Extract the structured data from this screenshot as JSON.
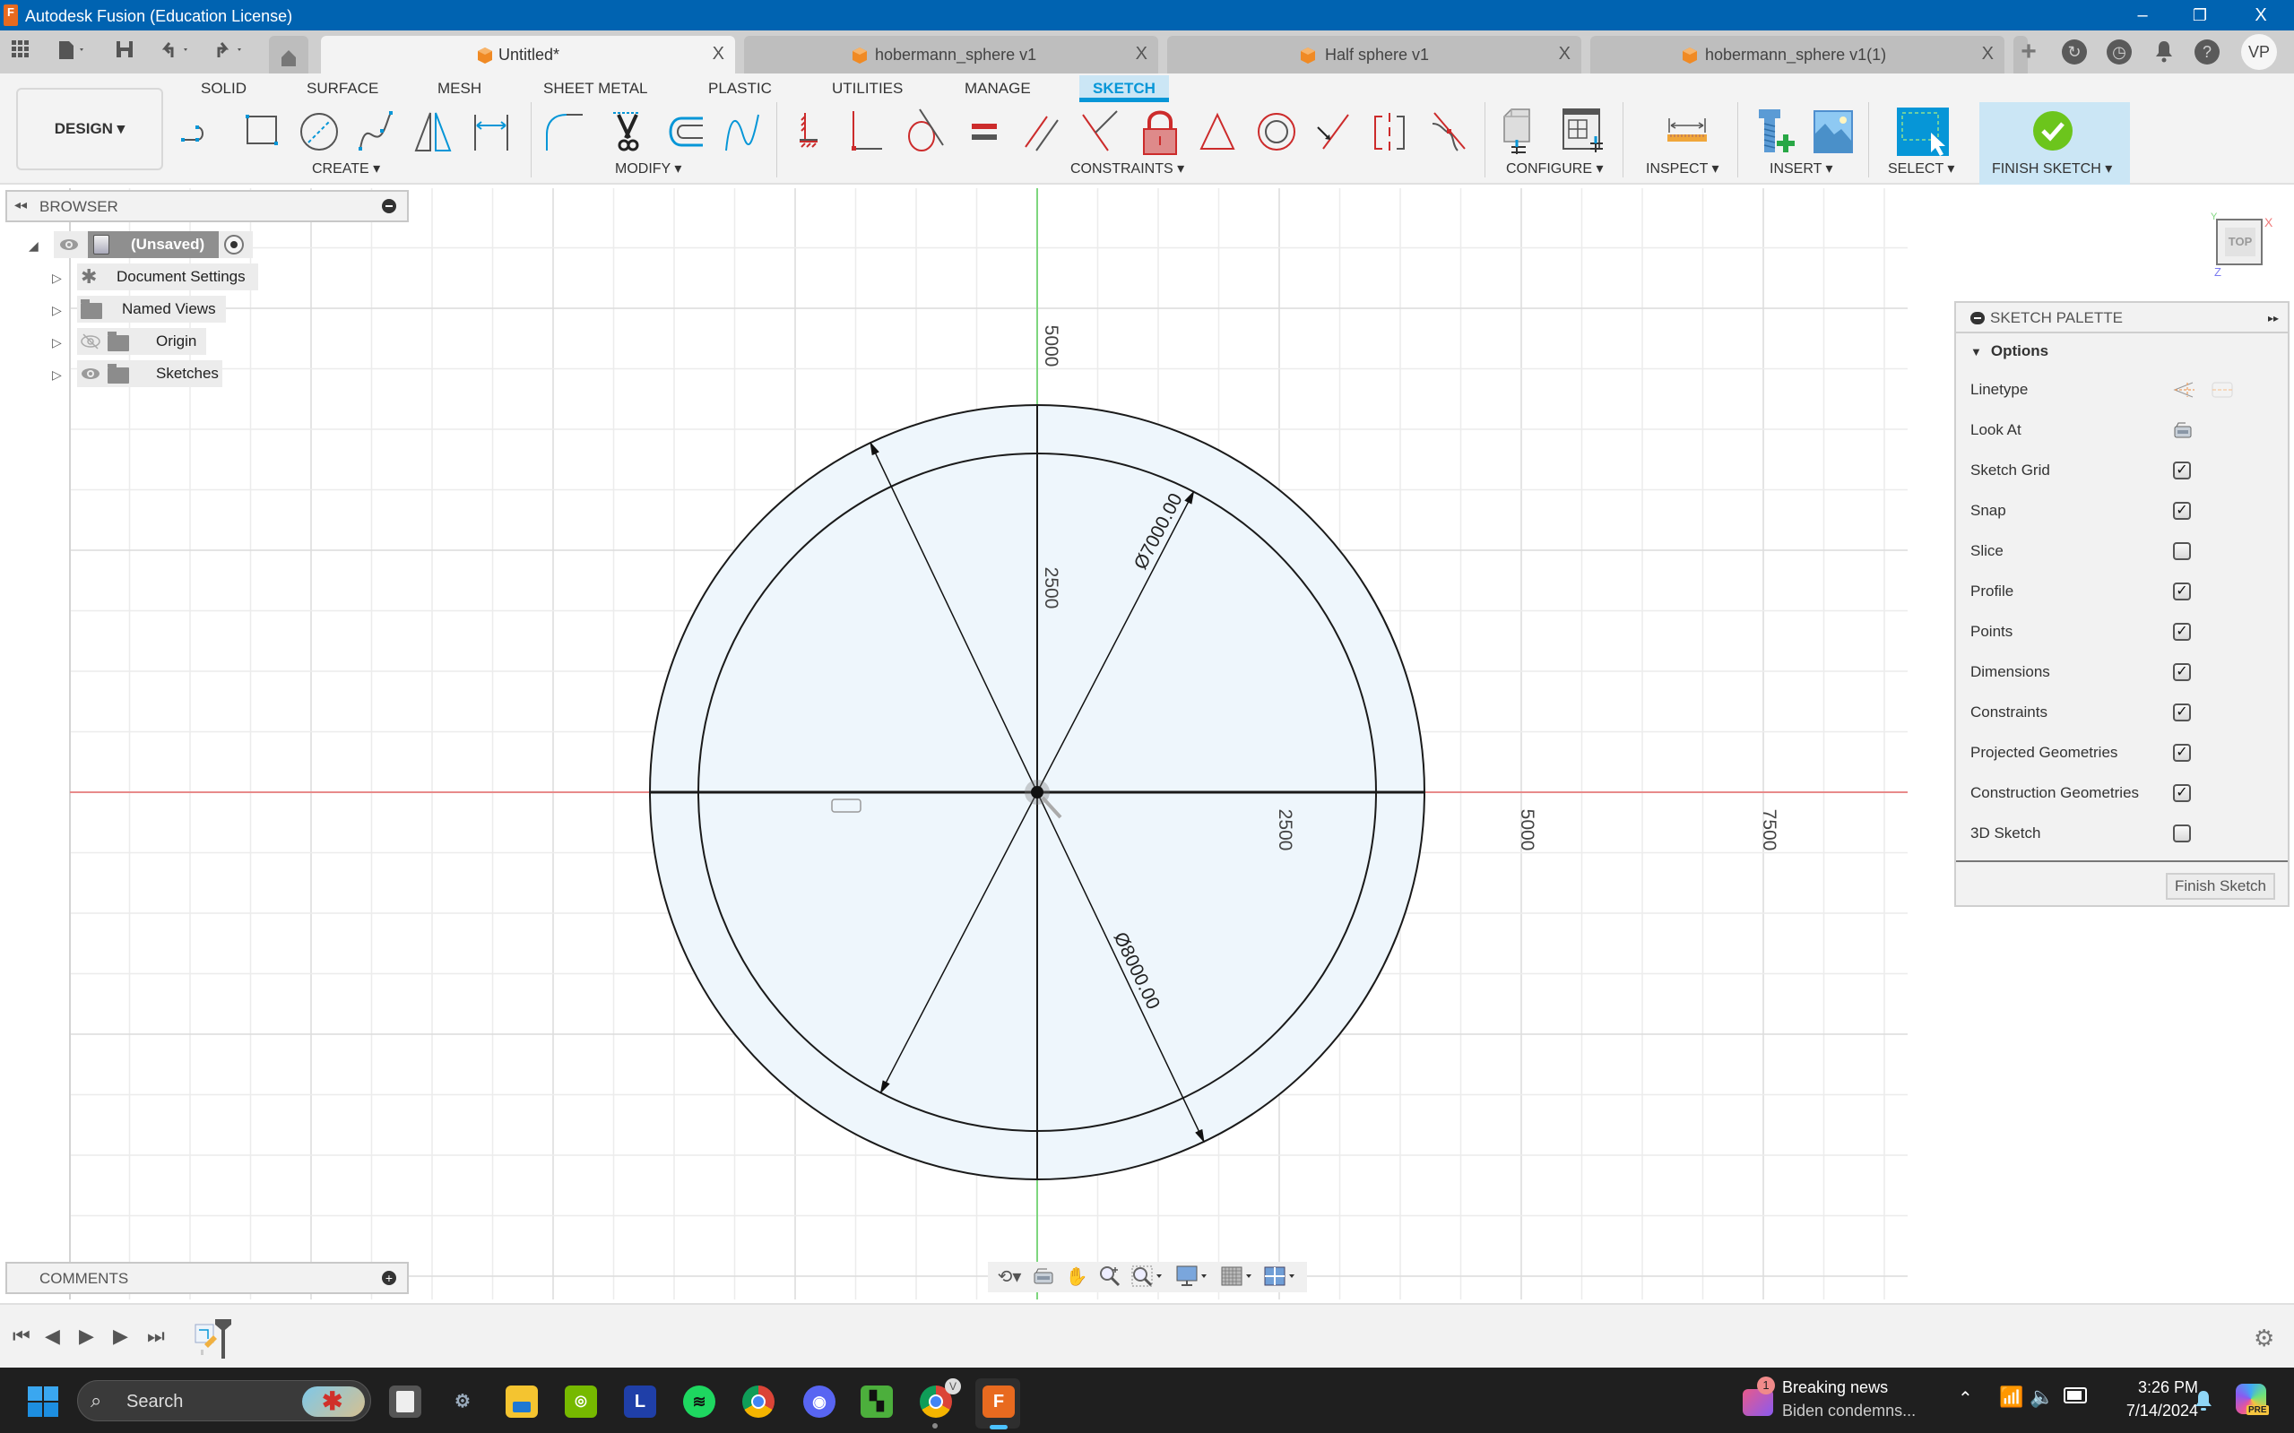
{
  "window": {
    "app_logo": "F",
    "title": "Autodesk Fusion (Education License)",
    "minimize": "–",
    "restore": "❐",
    "close": "X"
  },
  "quick_access": {
    "apps_icon": "grid-icon",
    "file_icon": "file-icon",
    "save_icon": "save-icon",
    "undo_icon": "undo-icon",
    "redo_icon": "redo-icon",
    "home_icon": "home-icon"
  },
  "tabs": [
    {
      "label": "Untitled*",
      "active": true
    },
    {
      "label": "hobermann_sphere v1",
      "active": false
    },
    {
      "label": "Half sphere v1",
      "active": false
    },
    {
      "label": "hobermann_sphere v1(1)",
      "active": false
    }
  ],
  "tab_close": "X",
  "tab_new": "+",
  "right_icons": [
    "job-status-icon",
    "history-icon",
    "notifications-icon",
    "help-icon"
  ],
  "user_initials": "VP",
  "ribbon": {
    "workspace": "DESIGN ▾",
    "workspace_tabs": [
      "SOLID",
      "SURFACE",
      "MESH",
      "SHEET METAL",
      "PLASTIC",
      "UTILITIES",
      "MANAGE",
      "SKETCH"
    ],
    "active_tab": "SKETCH",
    "groups": {
      "create": "CREATE ▾",
      "modify": "MODIFY ▾",
      "constraints": "CONSTRAINTS ▾",
      "configure": "CONFIGURE ▾",
      "inspect": "INSPECT ▾",
      "insert": "INSERT ▾",
      "select": "SELECT ▾",
      "finish": "FINISH SKETCH ▾"
    }
  },
  "browser": {
    "title": "BROWSER",
    "root": "(Unsaved)",
    "items": [
      {
        "label": "Document Settings",
        "icon": "gear-icon",
        "visible": null
      },
      {
        "label": "Named Views",
        "icon": "folder-icon",
        "visible": null
      },
      {
        "label": "Origin",
        "icon": "folder-icon",
        "visible": false
      },
      {
        "label": "Sketches",
        "icon": "folder-icon",
        "visible": true
      }
    ]
  },
  "comments": {
    "title": "COMMENTS"
  },
  "viewcube": {
    "face": "TOP",
    "x": "X",
    "y": "Y",
    "z": "Z"
  },
  "sketch": {
    "axis_labels_x": [
      "2500",
      "5000",
      "7500"
    ],
    "axis_labels_y": [
      "2500",
      "5000"
    ],
    "dim_inner": "Ø7000.00",
    "dim_outer": "Ø8000.00",
    "inner_diameter": 7000,
    "outer_diameter": 8000,
    "grid_major_step": 2500,
    "colors": {
      "x_axis": "#e88a8a",
      "y_axis": "#7ed67e",
      "profile_fill": "#eef6fc",
      "geometry": "#1a1a1a"
    }
  },
  "palette": {
    "title": "SKETCH PALETTE",
    "section": "Options",
    "linetype_label": "Linetype",
    "lookat_label": "Look At",
    "options": [
      {
        "label": "Sketch Grid",
        "checked": true
      },
      {
        "label": "Snap",
        "checked": true
      },
      {
        "label": "Slice",
        "checked": false
      },
      {
        "label": "Profile",
        "checked": true
      },
      {
        "label": "Points",
        "checked": true
      },
      {
        "label": "Dimensions",
        "checked": true
      },
      {
        "label": "Constraints",
        "checked": true
      },
      {
        "label": "Projected Geometries",
        "checked": true
      },
      {
        "label": "Construction Geometries",
        "checked": true
      },
      {
        "label": "3D Sketch",
        "checked": false
      }
    ],
    "finish_button": "Finish Sketch"
  },
  "taskbar": {
    "search_placeholder": "Search",
    "apps": [
      "task-view",
      "settings",
      "file-explorer",
      "nvidia",
      "L-app",
      "spotify",
      "chrome",
      "discord",
      "minecraft",
      "chrome-profile",
      "fusion"
    ],
    "fusion_label": "F",
    "news_badge": "1",
    "news_title": "Breaking news",
    "news_subtitle": "Biden condemns...",
    "time": "3:26 PM",
    "date": "7/14/2024",
    "copilot_badge": "PRE"
  }
}
